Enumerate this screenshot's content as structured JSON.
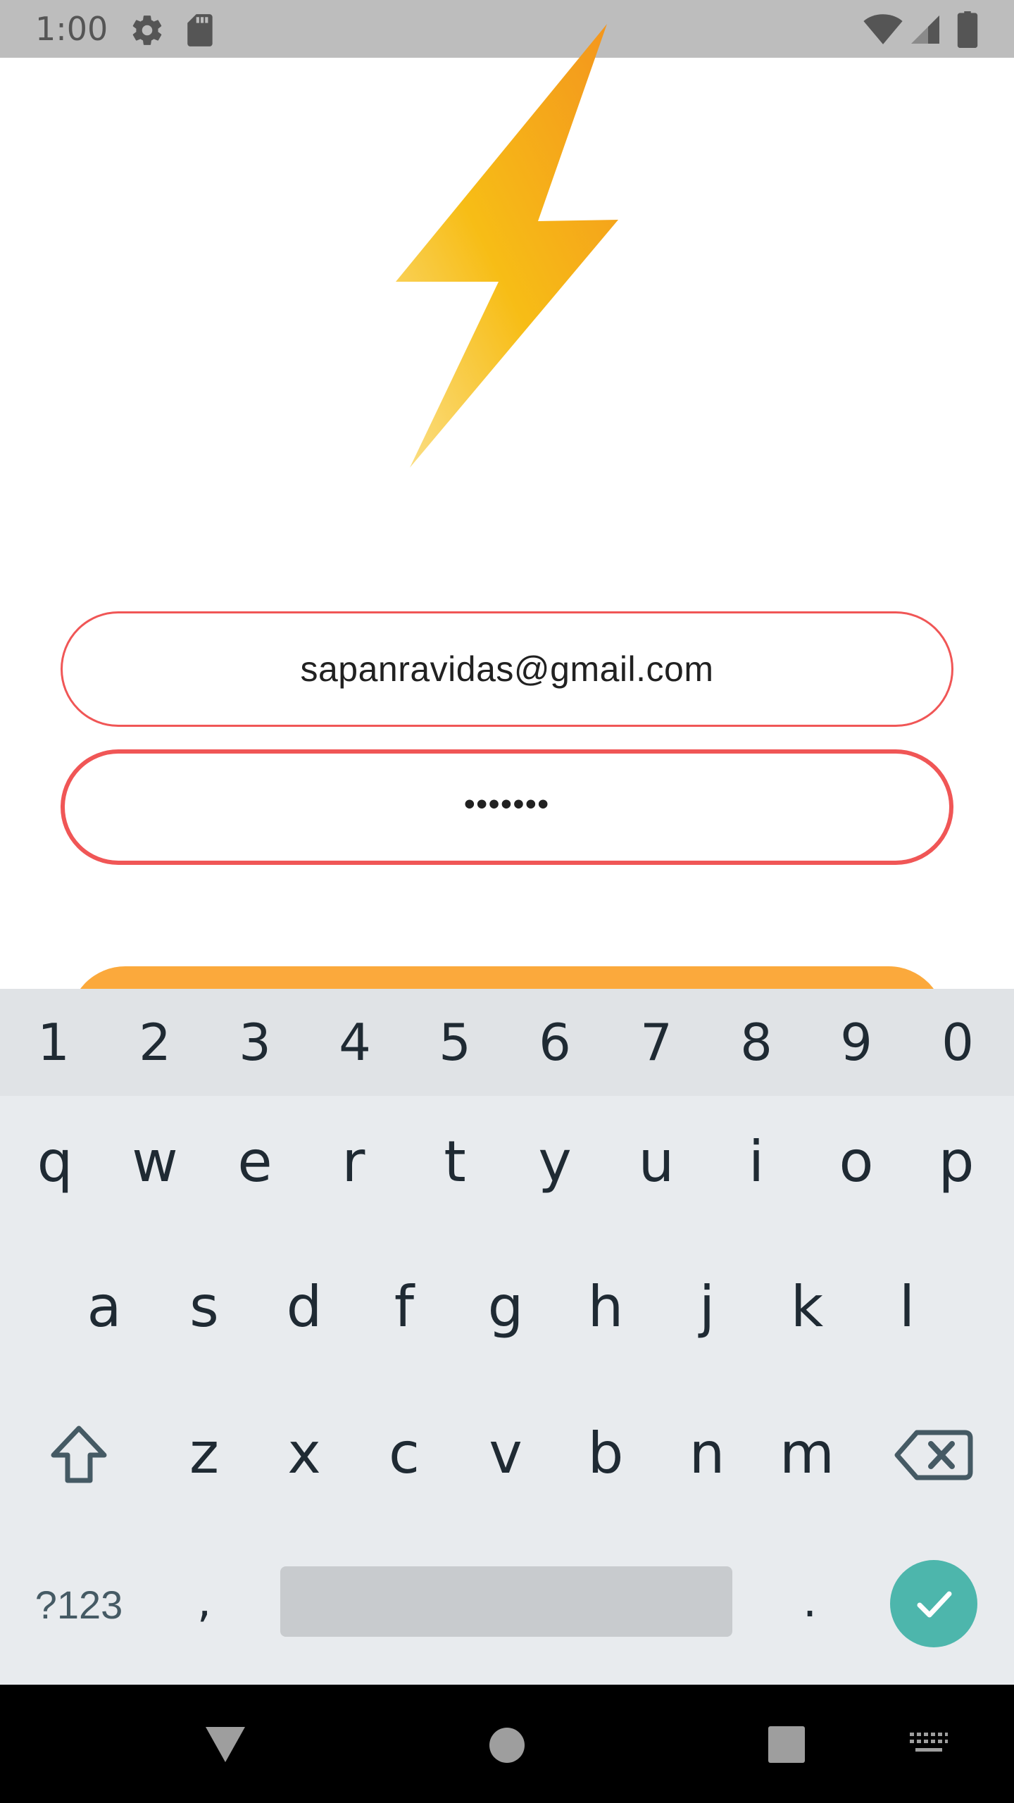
{
  "status_bar": {
    "time": "1:00",
    "icons": [
      "gear-icon",
      "sd-card-icon",
      "wifi-icon",
      "signal-icon",
      "battery-icon"
    ]
  },
  "logo": {
    "icon": "lightning-bolt-icon"
  },
  "form": {
    "email_value": "sapanravidas@gmail.com",
    "password_value": "•••••••",
    "field_border_color": "#f05656",
    "button_color": "#fba93c"
  },
  "keyboard": {
    "number_row": [
      "1",
      "2",
      "3",
      "4",
      "5",
      "6",
      "7",
      "8",
      "9",
      "0"
    ],
    "row_q": [
      "q",
      "w",
      "e",
      "r",
      "t",
      "y",
      "u",
      "i",
      "o",
      "p"
    ],
    "row_a": [
      "a",
      "s",
      "d",
      "f",
      "g",
      "h",
      "j",
      "k",
      "l"
    ],
    "row_z": [
      "z",
      "x",
      "c",
      "v",
      "b",
      "n",
      "m"
    ],
    "symbols_label": "?123",
    "comma": ",",
    "period": ".",
    "enter_icon": "check-icon",
    "enter_color": "#4db6ac"
  },
  "nav_bar": {
    "icons": [
      "back-icon",
      "home-icon",
      "recents-icon",
      "keyboard-switch-icon"
    ]
  }
}
